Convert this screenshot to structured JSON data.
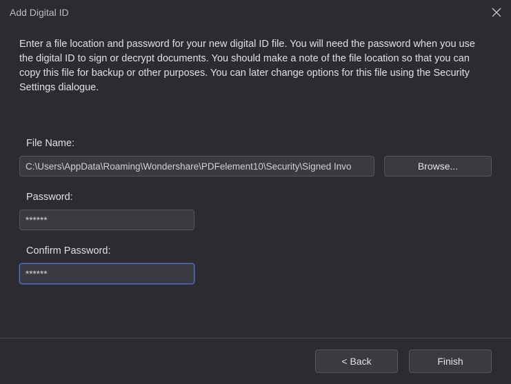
{
  "dialog": {
    "title": "Add Digital ID",
    "intro": "Enter a file location and password for your new digital ID file. You will need the password when you use the digital ID to sign or decrypt documents. You should make a note of the file location so that you can copy this file for backup or other purposes. You can later change options for this file using the Security Settings dialogue."
  },
  "fields": {
    "file_label": "File Name:",
    "file_value": "C:\\Users\\AppData\\Roaming\\Wondershare\\PDFelement10\\Security\\Signed Invo",
    "browse_label": "Browse...",
    "pw_label": "Password:",
    "pw_value": "******",
    "confirm_label": "Confirm Password:",
    "confirm_value": "******"
  },
  "footer": {
    "back_label": "< Back",
    "finish_label": "Finish"
  }
}
